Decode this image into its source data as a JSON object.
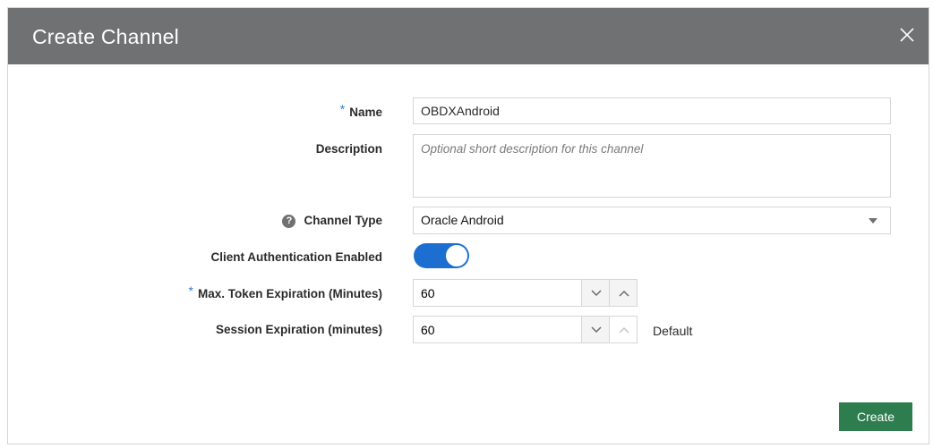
{
  "dialog": {
    "title": "Create Channel",
    "close_icon": "close-icon"
  },
  "form": {
    "name": {
      "label": "Name",
      "required": "*",
      "value": "OBDXAndroid"
    },
    "description": {
      "label": "Description",
      "placeholder": "Optional short description for this channel",
      "value": ""
    },
    "channel_type": {
      "label": "Channel Type",
      "help_icon": "?",
      "value": "Oracle Android"
    },
    "client_auth": {
      "label": "Client Authentication Enabled",
      "enabled": true
    },
    "max_token": {
      "label": "Max. Token Expiration (Minutes)",
      "required": "*",
      "value": "60"
    },
    "session": {
      "label": "Session Expiration (minutes)",
      "value": "60",
      "default_label": "Default"
    }
  },
  "actions": {
    "create_label": "Create"
  },
  "colors": {
    "header": "#6f7173",
    "accent": "#1c6fd1",
    "required": "#2a7fd4",
    "create_button": "#2e7d4f"
  }
}
